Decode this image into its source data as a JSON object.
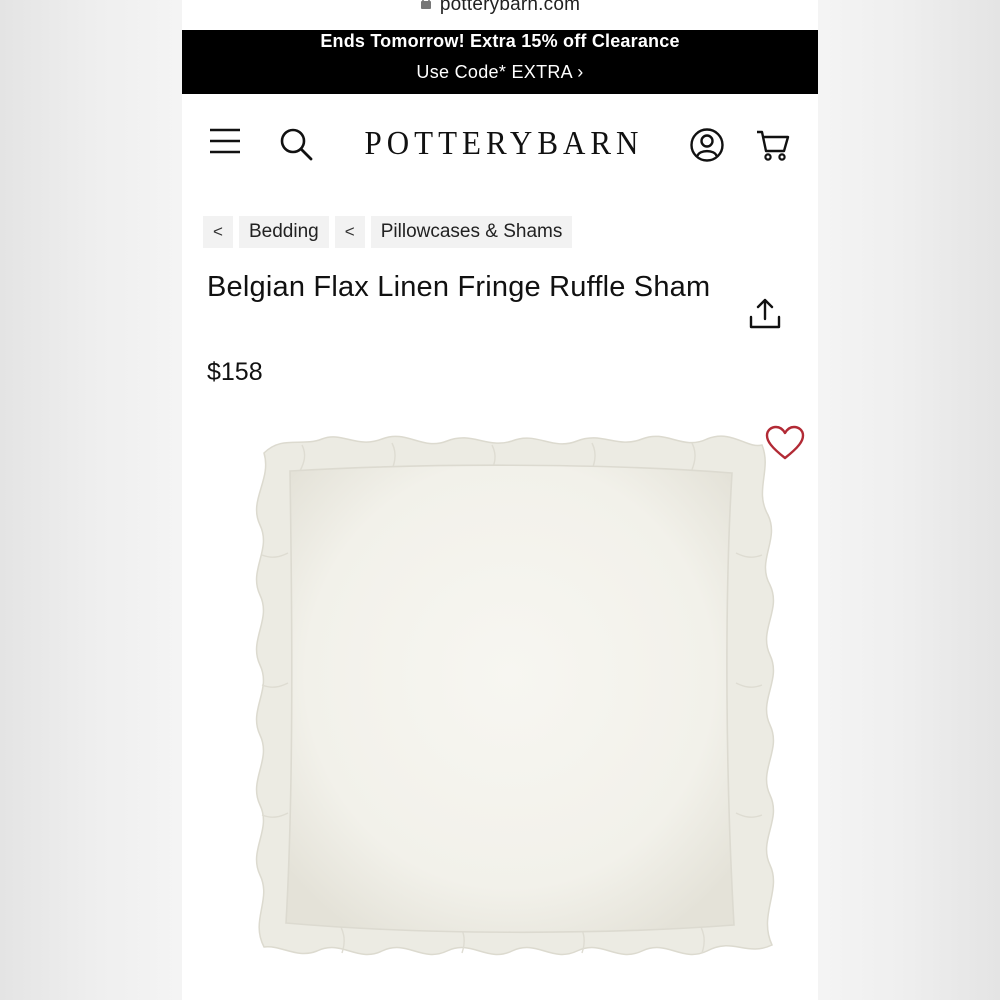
{
  "browser": {
    "url": "potterybarn.com"
  },
  "promo": {
    "line1": "Ends Tomorrow! Extra 15% off Clearance",
    "line2": "Use Code* EXTRA ›"
  },
  "header": {
    "logo": "POTTERYBARN",
    "icons": [
      "menu-icon",
      "search-icon",
      "account-icon",
      "cart-icon"
    ]
  },
  "breadcrumb": {
    "back_glyph": "<",
    "items": [
      {
        "label": "Bedding"
      },
      {
        "label": "Pillowcases & Shams"
      }
    ]
  },
  "product": {
    "title": "Belgian Flax Linen Fringe Ruffle Sham",
    "price": "$158",
    "image_alt": "white ruffle-edged linen sham",
    "colors": {
      "product": "#f6f5ef",
      "wishlist": "#b22a35"
    }
  }
}
